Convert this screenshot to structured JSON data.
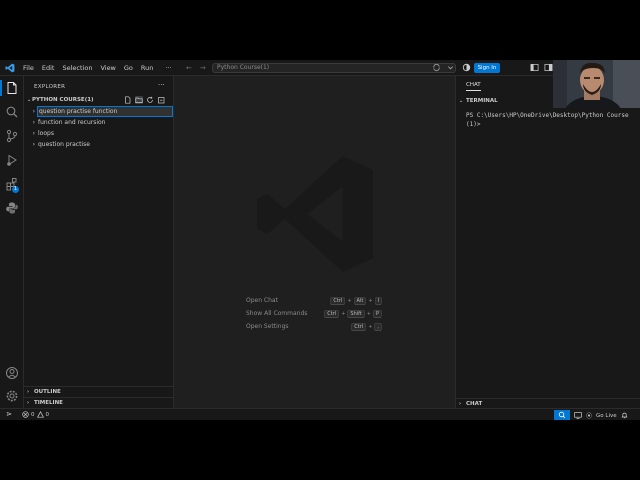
{
  "titlebar": {
    "menu": [
      "File",
      "Edit",
      "Selection",
      "View",
      "Go",
      "Run",
      "···"
    ],
    "search_text": "Python Course(1)",
    "sign_in": "Sign In",
    "accent": "#0078d4"
  },
  "activity_bar": {
    "icons": [
      "explorer-icon",
      "search-icon",
      "source-control-icon",
      "run-debug-icon",
      "extensions-icon",
      "python-icon",
      "account-icon",
      "settings-gear-icon"
    ],
    "extensions_badge": "1"
  },
  "explorer": {
    "title": "EXPLORER",
    "more": "···",
    "section": "PYTHON COURSE(1)",
    "new_item_input": "question practise function",
    "folders": [
      "function and recursion",
      "loops",
      "question practise"
    ],
    "outline": "OUTLINE",
    "timeline": "TIMELINE"
  },
  "editor": {
    "shortcuts": [
      {
        "label": "Open Chat",
        "keys": [
          "Ctrl",
          "Alt",
          "I"
        ]
      },
      {
        "label": "Show All Commands",
        "keys": [
          "Ctrl",
          "Shift",
          "P"
        ]
      },
      {
        "label": "Open Settings",
        "keys": [
          "Ctrl",
          ","
        ]
      }
    ]
  },
  "right_panel": {
    "chat_tab": "CHAT",
    "terminal_header": "TERMINAL",
    "terminal_text": "PS C:\\Users\\HP\\OneDrive\\Desktop\\Python Course(1)>",
    "chat_header": "CHAT"
  },
  "statusbar": {
    "errors": "0",
    "warnings": "0",
    "go_live": "Go Live"
  }
}
